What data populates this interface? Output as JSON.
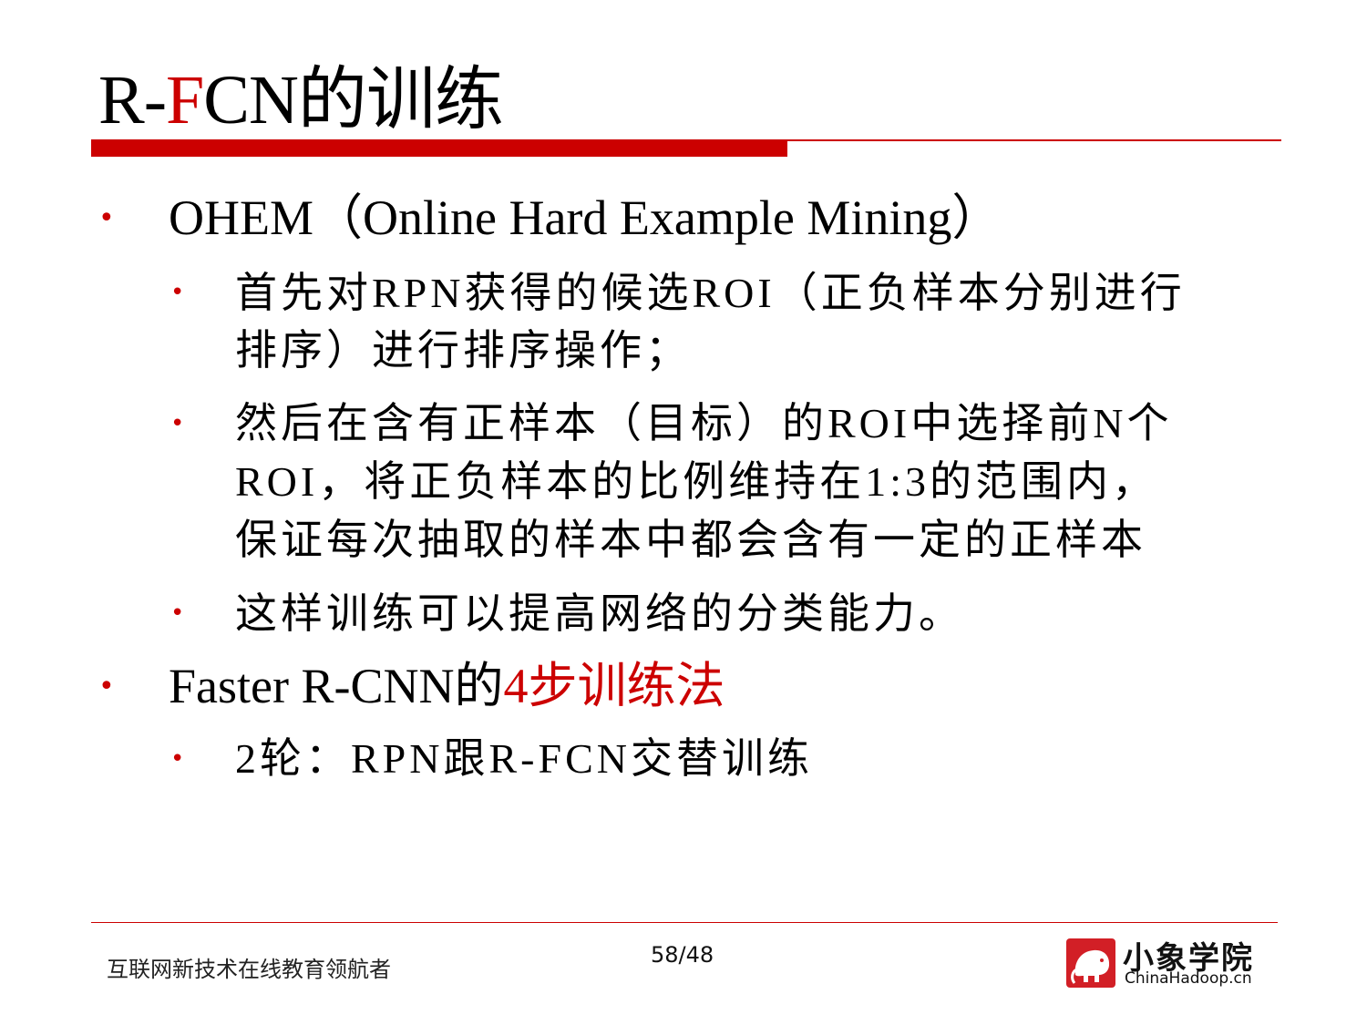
{
  "title": {
    "part1": "R-",
    "part2": "F",
    "part3": "CN的训练"
  },
  "bullets": {
    "ohem": "OHEM（Online Hard Example Mining）",
    "ohem_sub1_line1": "首先对RPN获得的候选ROI（正负样本分别进行",
    "ohem_sub1_line2": "排序）进行排序操作；",
    "ohem_sub2_line1": "然后在含有正样本（目标）的ROI中选择前N个",
    "ohem_sub2_line2": "ROI，将正负样本的比例维持在1:3的范围内，",
    "ohem_sub2_line3": "保证每次抽取的样本中都会含有一定的正样本",
    "ohem_sub3": "这样训练可以提高网络的分类能力。",
    "faster_prefix": "Faster R-CNN的",
    "faster_highlight": "4步训练法",
    "faster_sub1": "2轮：RPN跟R-FCN交替训练"
  },
  "footer": {
    "slogan": "互联网新技术在线教育领航者",
    "page": "58/48",
    "logo_cn": "小象学院",
    "logo_en": "ChinaHadoop.cn"
  },
  "colors": {
    "accent": "#cc0000"
  }
}
